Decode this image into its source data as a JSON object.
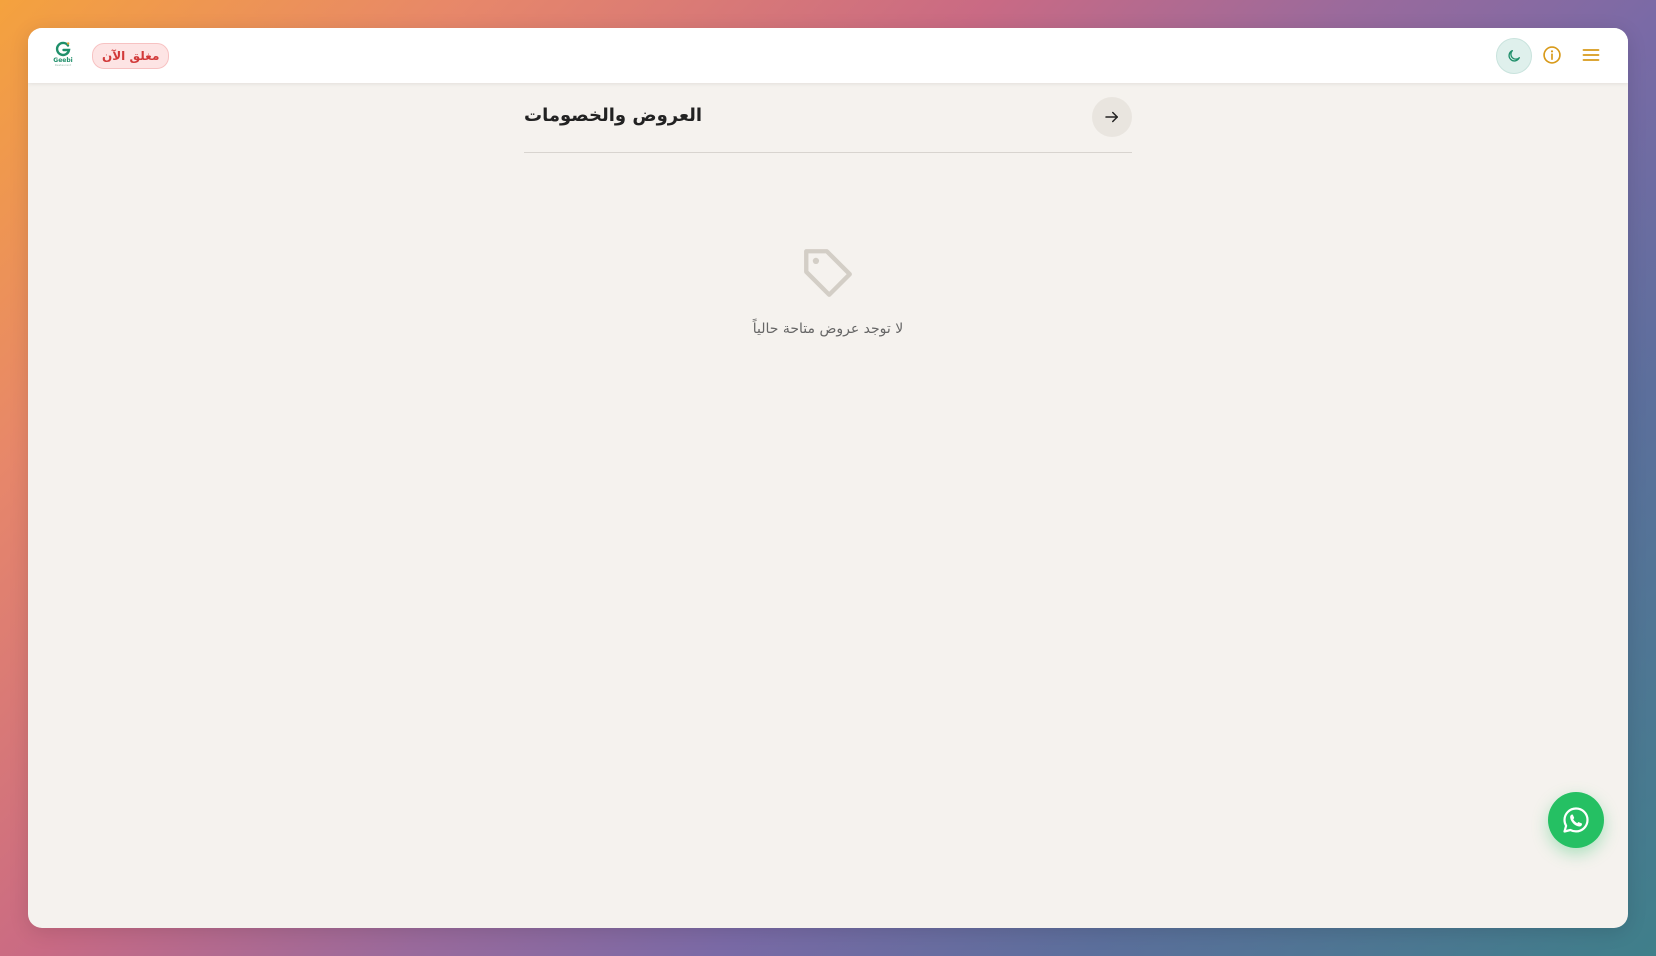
{
  "header": {
    "logo_text": "Geebi",
    "logo_subtext": "Restaurant",
    "status_badge": "مغلق الآن",
    "icons": {
      "theme": "moon-icon",
      "info": "info-icon",
      "menu": "hamburger-menu-icon"
    }
  },
  "page": {
    "title": "العروض والخصومات",
    "back_icon": "arrow-right-icon"
  },
  "empty_state": {
    "icon": "tag-icon",
    "message": "لا توجد عروض متاحة حالياً"
  },
  "floating": {
    "whatsapp_icon": "whatsapp-icon"
  },
  "colors": {
    "accent_green": "#1f8f6a",
    "info_orange": "#d89a1a",
    "closed_red": "#d23a3a",
    "whatsapp_green": "#25c063",
    "page_bg": "#f5f2ee"
  }
}
